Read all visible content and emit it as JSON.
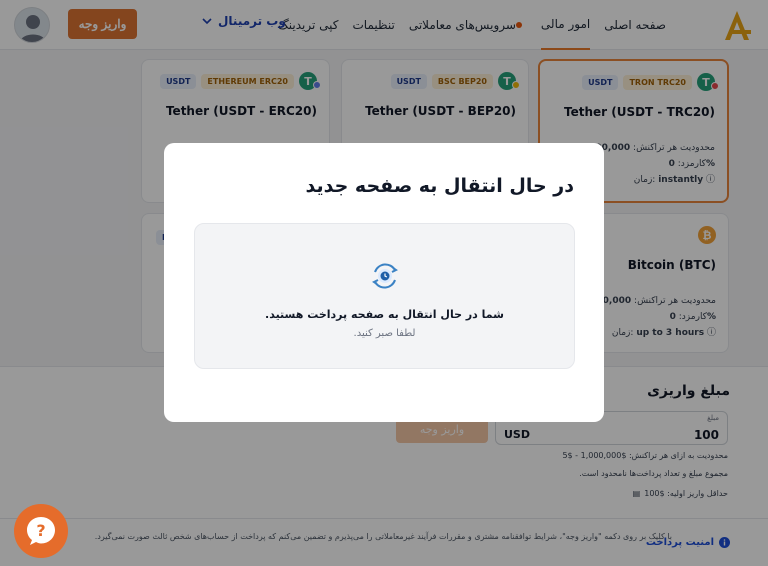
{
  "header": {
    "logo_text": "A",
    "nav": [
      {
        "label": "صفحه اصلی",
        "active": false
      },
      {
        "label": "امور مالی",
        "active": true
      },
      {
        "label": "سرویس‌های معاملاتی",
        "active": false,
        "dot": true
      },
      {
        "label": "تنظیمات",
        "active": false
      },
      {
        "label": "کپی تریدینگ",
        "active": false
      }
    ],
    "web_terminal_label": "وب ترمینال",
    "deposit_button_label": "واریز وجه",
    "colors": {
      "accent": "#dd7432",
      "link": "#1e40af"
    }
  },
  "cards": [
    {
      "title": "Tether (USDT - TRC20)",
      "network_badge": "TRON TRC20",
      "currency_badge": "USDT",
      "icon": "tether-icon",
      "selected": true,
      "limit_label": "محدودیت هر تراکنش:",
      "limit_value": "1,000,000",
      "fee_label": "کارمزد:",
      "fee_value": "0%",
      "time_label": "زمان:",
      "time_value": "instantly"
    },
    {
      "title": "Tether (USDT - BEP20)",
      "network_badge": "BSC BEP20",
      "currency_badge": "USDT",
      "icon": "tether-icon",
      "selected": false
    },
    {
      "title": "Tether (USDT - ERC20)",
      "network_badge": "ETHEREUM ERC20",
      "currency_badge": "USDT",
      "icon": "tether-icon",
      "selected": false
    },
    {
      "title": "Bitcoin (BTC)",
      "icon": "bitcoin-icon",
      "selected": false,
      "limit_label": "محدودیت هر تراکنش:",
      "limit_value": "1,000,000",
      "fee_label": "کارمزد:",
      "fee_value": "0%",
      "time_label": "زمان:",
      "time_value": "up to 3 hours"
    }
  ],
  "partial_card_badge": "E",
  "amount": {
    "title": "مبلغ واریزی",
    "field_label": "مبلغ",
    "value": "100",
    "currency": "USD",
    "submit_label": "واریز وجه",
    "note_limit": "محدودیت به ازای هر تراکنش: $1,000,000 - $5",
    "note_total": "مجموع مبلغ و تعداد پرداخت‌ها نامحدود است.",
    "note_min": "حداقل واریز اولیه: $100"
  },
  "footer": {
    "security_label": "امنیت پرداخت",
    "terms_text": "با کلیک بر روی دکمه \"واریز وجه\"، شرایط توافقنامه مشتری و مقررات فرآیند غیرمعاملاتی را می‌پذیرم و تضمین می‌کنم که پرداخت از حساب‌های شخص ثالث صورت نمی‌گیرد."
  },
  "modal": {
    "title": "در حال انتقال به صفحه جدید",
    "message": "شما در حال انتقال به صفحه پرداخت هستید.",
    "sub_message": "لطفا صبر کنید."
  },
  "help_button_icon": "question-icon"
}
